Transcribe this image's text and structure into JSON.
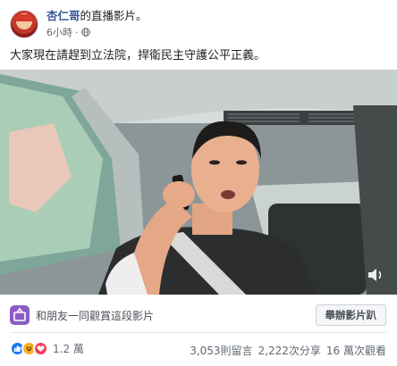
{
  "post": {
    "author": "杏仁哥",
    "action": "的直播影片。",
    "time": "6小時",
    "separator": "·",
    "privacy_icon": "globe-icon",
    "caption": "大家現在請趕到立法院，捍衛民主守護公平正義。"
  },
  "video": {
    "description_icon": "live-video-still"
  },
  "watch_party": {
    "text": "和朋友一同觀賞這段影片",
    "button_label": "舉辦影片趴"
  },
  "stats": {
    "reactions": [
      "like",
      "haha",
      "love"
    ],
    "reaction_count": "1.2 萬",
    "comments": "3,053則留言",
    "shares": "2,222次分享",
    "views": "16 萬次觀看"
  },
  "colors": {
    "author": "#385898",
    "watch_icon": "#8b5cc6",
    "like": "#1877f2",
    "love": "#f33e58",
    "haha": "#f7b125"
  }
}
